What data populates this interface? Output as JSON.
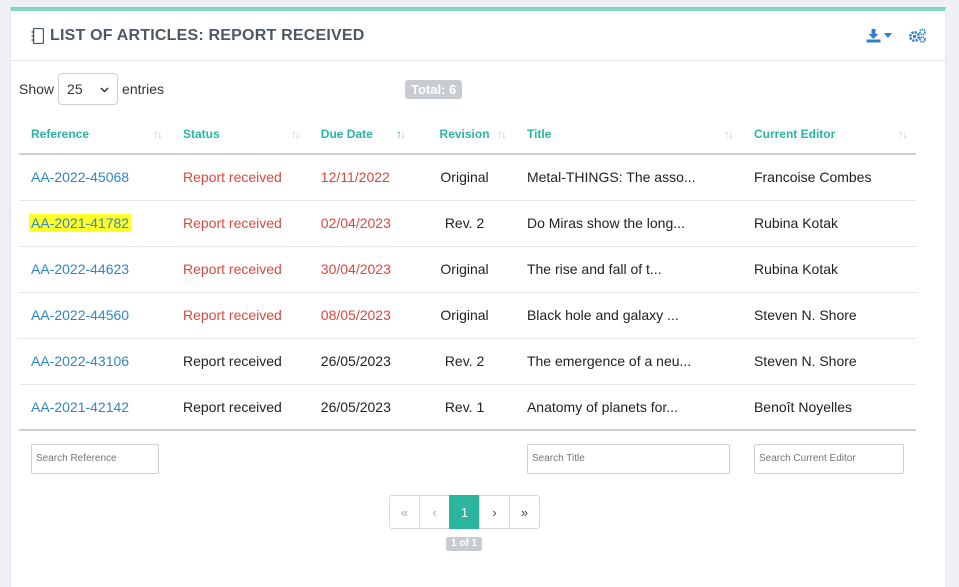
{
  "panel": {
    "title": "LIST OF ARTICLES: REPORT RECEIVED",
    "icons": {
      "title": "notebook-icon",
      "download": "download-icon",
      "settings": "cogs-icon"
    },
    "accent_color": "#7dd7c7"
  },
  "controls": {
    "show_label": "Show",
    "entries_value": "25",
    "entries_label": "entries",
    "total": "Total: 6"
  },
  "table": {
    "columns": [
      "Reference",
      "Status",
      "Due Date",
      "Revision",
      "Title",
      "Current Editor"
    ],
    "sorted_column": "Due Date",
    "rows": [
      {
        "reference": "AA-2022-45068",
        "status": "Report received",
        "due_date": "12/11/2022",
        "revision": "Original",
        "title": "Metal-THINGS: The asso...",
        "editor": "Francoise Combes",
        "overdue": true
      },
      {
        "reference": "AA-2021-41782",
        "status": "Report received",
        "due_date": "02/04/2023",
        "revision": "Rev. 2",
        "title": "Do Miras show the long...",
        "editor": "Rubina Kotak",
        "overdue": true,
        "highlighted": true
      },
      {
        "reference": "AA-2022-44623",
        "status": "Report received",
        "due_date": "30/04/2023",
        "revision": "Original",
        "title": "The rise and fall of t...",
        "editor": "Rubina Kotak",
        "overdue": true
      },
      {
        "reference": "AA-2022-44560",
        "status": "Report received",
        "due_date": "08/05/2023",
        "revision": "Original",
        "title": "Black hole and galaxy ...",
        "editor": "Steven N. Shore",
        "overdue": true
      },
      {
        "reference": "AA-2022-43106",
        "status": "Report received",
        "due_date": "26/05/2023",
        "revision": "Rev. 2",
        "title": "The emergence of a neu...",
        "editor": "Steven N. Shore",
        "overdue": false
      },
      {
        "reference": "AA-2021-42142",
        "status": "Report received",
        "due_date": "26/05/2023",
        "revision": "Rev. 1",
        "title": "Anatomy of planets for...",
        "editor": "Benoît Noyelles",
        "overdue": false
      }
    ],
    "filters": {
      "reference_placeholder": "Search Reference",
      "title_placeholder": "Search Title",
      "editor_placeholder": "Search Current Editor"
    }
  },
  "pagination": {
    "first": "«",
    "prev": "‹",
    "current": "1",
    "next": "›",
    "last": "»",
    "info": "1 of 1"
  },
  "colors": {
    "link": "#2f86c8",
    "overdue": "#e0463c",
    "header": "#2bb5a3",
    "highlight": "#ffff29"
  }
}
